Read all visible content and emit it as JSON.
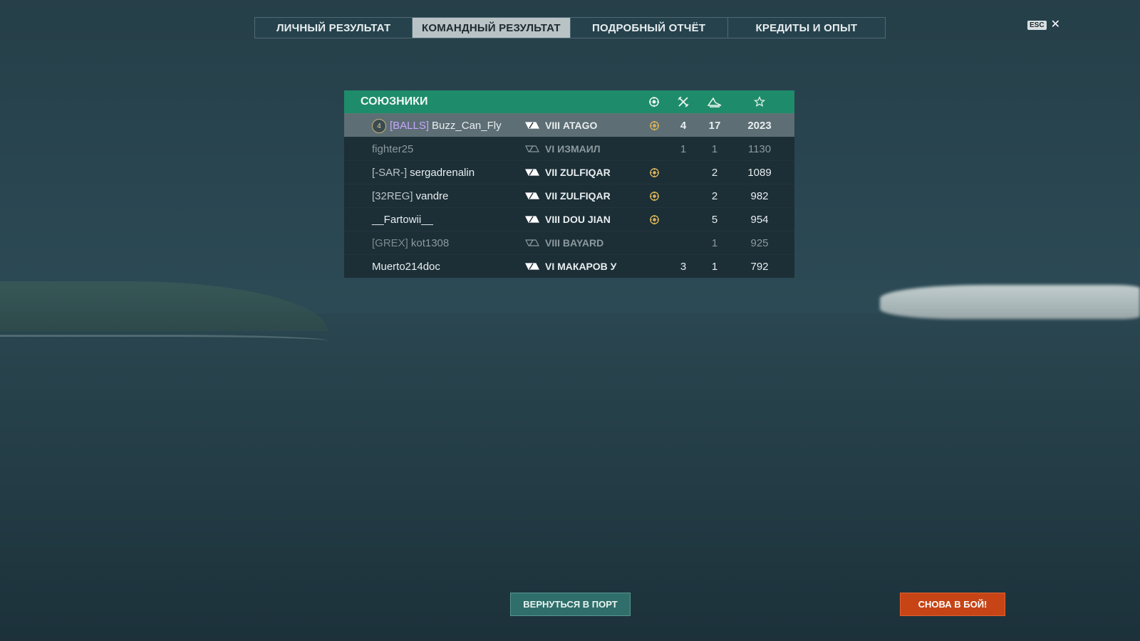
{
  "tabs": [
    {
      "label": "ЛИЧНЫЙ РЕЗУЛЬТАТ",
      "active": false
    },
    {
      "label": "КОМАНДНЫЙ РЕЗУЛЬТАТ",
      "active": true
    },
    {
      "label": "ПОДРОБНЫЙ ОТЧЁТ",
      "active": false
    },
    {
      "label": "КРЕДИТЫ И ОПЫТ",
      "active": false
    }
  ],
  "esc": {
    "label": "ESC",
    "close": "✕"
  },
  "panel": {
    "title": "СОЮЗНИКИ",
    "header_icons": [
      "medal-icon",
      "kills-icon",
      "planes-icon",
      "star-icon"
    ],
    "rows": [
      {
        "rank": "4",
        "clan": "[BALLS]",
        "name": "Buzz_Can_Fly",
        "tier": "VIII",
        "ship": "ATAGO",
        "medal": true,
        "kills": "4",
        "planes": "17",
        "score": "2023",
        "highlight": true,
        "dim": false
      },
      {
        "rank": "",
        "clan": "",
        "name": "fighter25",
        "tier": "VI",
        "ship": "ИЗМАИЛ",
        "medal": false,
        "kills": "1",
        "planes": "1",
        "score": "1130",
        "highlight": false,
        "dim": true
      },
      {
        "rank": "",
        "clan": "[-SAR-]",
        "name": "sergadrenalin",
        "tier": "VII",
        "ship": "ZULFIQAR",
        "medal": true,
        "kills": "",
        "planes": "2",
        "score": "1089",
        "highlight": false,
        "dim": false
      },
      {
        "rank": "",
        "clan": "[32REG]",
        "name": "vandre",
        "tier": "VII",
        "ship": "ZULFIQAR",
        "medal": true,
        "kills": "",
        "planes": "2",
        "score": "982",
        "highlight": false,
        "dim": false
      },
      {
        "rank": "",
        "clan": "",
        "name": "__Fartowii__",
        "tier": "VIII",
        "ship": "DOU JIAN",
        "medal": true,
        "kills": "",
        "planes": "5",
        "score": "954",
        "highlight": false,
        "dim": false
      },
      {
        "rank": "",
        "clan": "[GREX]",
        "name": "kot1308",
        "tier": "VIII",
        "ship": "BAYARD",
        "medal": false,
        "kills": "",
        "planes": "1",
        "score": "925",
        "highlight": false,
        "dim": true
      },
      {
        "rank": "",
        "clan": "",
        "name": "Muerto214doc",
        "tier": "VI",
        "ship": "МАКАРОВ У",
        "medal": false,
        "kills": "3",
        "planes": "1",
        "score": "792",
        "highlight": false,
        "dim": false
      }
    ]
  },
  "buttons": {
    "port": "ВЕРНУТЬСЯ В ПОРТ",
    "battle": "СНОВА В БОЙ!"
  },
  "colors": {
    "header_green": "#1e8c6a",
    "clan_purple": "#c6a6ff",
    "battle_orange": "#c64416",
    "port_teal": "#2f6e6a"
  }
}
